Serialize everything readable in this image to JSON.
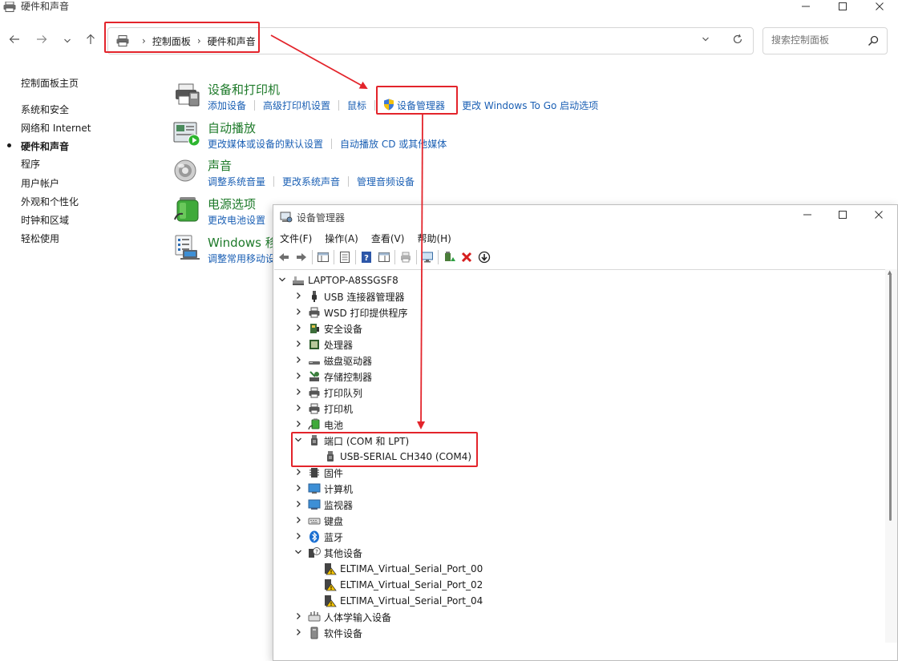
{
  "colors": {
    "link_blue": "#1a5fb4",
    "category_green": "#1e7a2a",
    "annotation_red": "#e3242b"
  },
  "window": {
    "title": "硬件和声音"
  },
  "breadcrumb": {
    "items": [
      "控制面板",
      "硬件和声音"
    ]
  },
  "search": {
    "placeholder": "搜索控制面板"
  },
  "sidebar": {
    "items": [
      {
        "label": "控制面板主页",
        "active": false
      },
      {
        "label": "系统和安全",
        "active": false
      },
      {
        "label": "网络和 Internet",
        "active": false
      },
      {
        "label": "硬件和声音",
        "active": true
      },
      {
        "label": "程序",
        "active": false
      },
      {
        "label": "用户帐户",
        "active": false
      },
      {
        "label": "外观和个性化",
        "active": false
      },
      {
        "label": "时钟和区域",
        "active": false
      },
      {
        "label": "轻松使用",
        "active": false
      }
    ]
  },
  "categories": [
    {
      "title": "设备和打印机",
      "icon": "printer-icon",
      "links": [
        "添加设备",
        "高级打印机设置",
        "鼠标",
        "设备管理器",
        "更改 Windows To Go 启动选项"
      ]
    },
    {
      "title": "自动播放",
      "icon": "autoplay-icon",
      "links": [
        "更改媒体或设备的默认设置",
        "自动播放 CD 或其他媒体"
      ]
    },
    {
      "title": "声音",
      "icon": "speaker-icon",
      "links": [
        "调整系统音量",
        "更改系统声音",
        "管理音频设备"
      ]
    },
    {
      "title": "电源选项",
      "icon": "battery-icon",
      "links": [
        "更改电池设置"
      ]
    },
    {
      "title": "Windows 移",
      "icon": "mobility-icon",
      "links": [
        "调整常用移动设"
      ]
    }
  ],
  "device_manager": {
    "title": "设备管理器",
    "menu": [
      "文件(F)",
      "操作(A)",
      "查看(V)",
      "帮助(H)"
    ],
    "root": "LAPTOP-A8SSGSF8",
    "nodes": [
      {
        "label": "USB 连接器管理器",
        "icon": "usb-icon",
        "expanded": false,
        "level": 1
      },
      {
        "label": "WSD 打印提供程序",
        "icon": "printer-icon",
        "expanded": false,
        "level": 1
      },
      {
        "label": "安全设备",
        "icon": "security-icon",
        "expanded": false,
        "level": 1
      },
      {
        "label": "处理器",
        "icon": "cpu-icon",
        "expanded": false,
        "level": 1
      },
      {
        "label": "磁盘驱动器",
        "icon": "disk-icon",
        "expanded": false,
        "level": 1
      },
      {
        "label": "存储控制器",
        "icon": "storage-icon",
        "expanded": false,
        "level": 1
      },
      {
        "label": "打印队列",
        "icon": "printer-icon",
        "expanded": false,
        "level": 1
      },
      {
        "label": "打印机",
        "icon": "printer-icon",
        "expanded": false,
        "level": 1
      },
      {
        "label": "电池",
        "icon": "battery-icon",
        "expanded": false,
        "level": 1
      },
      {
        "label": "端口 (COM 和 LPT)",
        "icon": "port-icon",
        "expanded": true,
        "level": 1
      },
      {
        "label": "USB-SERIAL CH340 (COM4)",
        "icon": "port-icon",
        "expanded": null,
        "level": 2
      },
      {
        "label": "固件",
        "icon": "firmware-icon",
        "expanded": false,
        "level": 1
      },
      {
        "label": "计算机",
        "icon": "computer-icon",
        "expanded": false,
        "level": 1
      },
      {
        "label": "监视器",
        "icon": "monitor-icon",
        "expanded": false,
        "level": 1
      },
      {
        "label": "键盘",
        "icon": "keyboard-icon",
        "expanded": false,
        "level": 1
      },
      {
        "label": "蓝牙",
        "icon": "bluetooth-icon",
        "expanded": false,
        "level": 1
      },
      {
        "label": "其他设备",
        "icon": "unknown-device-icon",
        "expanded": true,
        "level": 1
      },
      {
        "label": "ELTIMA_Virtual_Serial_Port_00",
        "icon": "warning-device-icon",
        "expanded": null,
        "level": 2
      },
      {
        "label": "ELTIMA_Virtual_Serial_Port_02",
        "icon": "warning-device-icon",
        "expanded": null,
        "level": 2
      },
      {
        "label": "ELTIMA_Virtual_Serial_Port_04",
        "icon": "warning-device-icon",
        "expanded": null,
        "level": 2
      },
      {
        "label": "人体学输入设备",
        "icon": "hid-icon",
        "expanded": false,
        "level": 1
      },
      {
        "label": "软件设备",
        "icon": "software-device-icon",
        "expanded": false,
        "level": 1
      }
    ]
  }
}
